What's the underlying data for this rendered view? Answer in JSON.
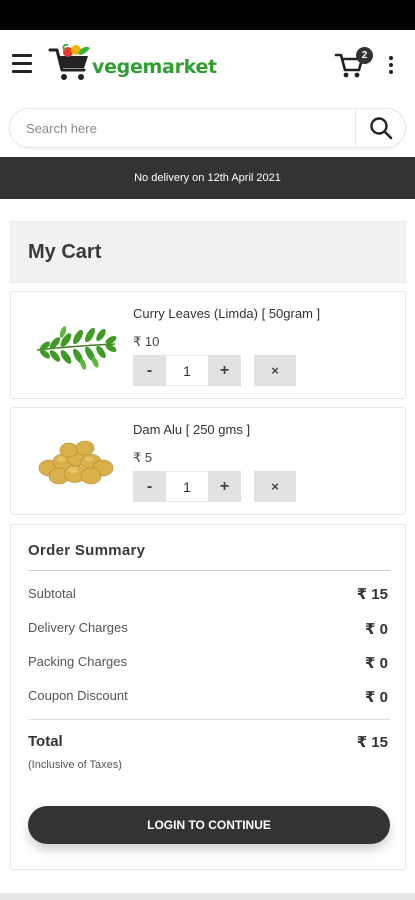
{
  "header": {
    "logo_text": "vegemarket",
    "cart_count": "2",
    "brand_color": "#2fa02f"
  },
  "search": {
    "placeholder": "Search here",
    "icon": "search-icon"
  },
  "banner": {
    "text": "No delivery on 12th April 2021"
  },
  "cart": {
    "title": "My Cart",
    "items": [
      {
        "name": "Curry Leaves (Limda) [ 50gram ]",
        "price": "₹ 10",
        "quantity": "1",
        "minus": "-",
        "plus": "+",
        "remove": "×",
        "image": "curry-leaves-image"
      },
      {
        "name": "Dam Alu [ 250 gms ]",
        "price": "₹ 5",
        "quantity": "1",
        "minus": "-",
        "plus": "+",
        "remove": "×",
        "image": "potatoes-image"
      }
    ]
  },
  "summary": {
    "title": "Order Summary",
    "subtotal_label": "Subtotal",
    "subtotal_value": "₹ 15",
    "delivery_label": "Delivery Charges",
    "delivery_value": "₹ 0",
    "packing_label": "Packing Charges",
    "packing_value": "₹ 0",
    "coupon_label": "Coupon Discount",
    "coupon_value": "₹ 0",
    "total_label": "Total",
    "total_note": "(Inclusive of Taxes)",
    "total_value": "₹ 15",
    "login_button": "LOGIN TO CONTINUE"
  }
}
